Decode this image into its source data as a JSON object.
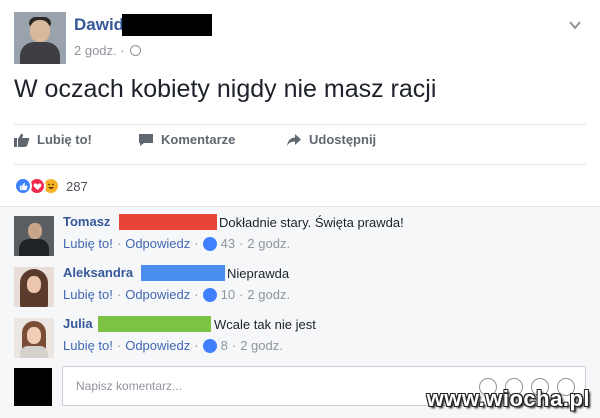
{
  "post": {
    "author": "Dawid",
    "time": "2 godz. ·",
    "text": "W oczach kobiety nigdy nie masz racji"
  },
  "actions": {
    "like": "Lubię to!",
    "comment": "Komentarze",
    "share": "Udostępnij"
  },
  "reactions": {
    "count": "287",
    "icons": [
      "like-icon",
      "love-icon",
      "haha-icon"
    ]
  },
  "comments": [
    {
      "name": "Tomasz",
      "redact_color": "#e8443a",
      "text": "Dokładnie stary. Święta prawda!",
      "like": "Lubię to!",
      "reply": "Odpowiedz",
      "likes": "43",
      "time": "2 godz."
    },
    {
      "name": "Aleksandra",
      "redact_color": "#4a8ef0",
      "text": "Nieprawda",
      "like": "Lubię to!",
      "reply": "Odpowiedz",
      "likes": "10",
      "time": "2 godz."
    },
    {
      "name": "Julia",
      "redact_color": "#7cc243",
      "text": "Wcale tak nie jest",
      "like": "Lubię to!",
      "reply": "Odpowiedz",
      "likes": "8",
      "time": "2 godz."
    }
  ],
  "composer": {
    "placeholder": "Napisz komentarz..."
  },
  "watermark": "www.wiocha.pl",
  "colors": {
    "link": "#365899",
    "meta": "#90949c",
    "like_blue": "#4080ff",
    "love_red": "#f0284a",
    "haha_yellow": "#f7b125"
  }
}
